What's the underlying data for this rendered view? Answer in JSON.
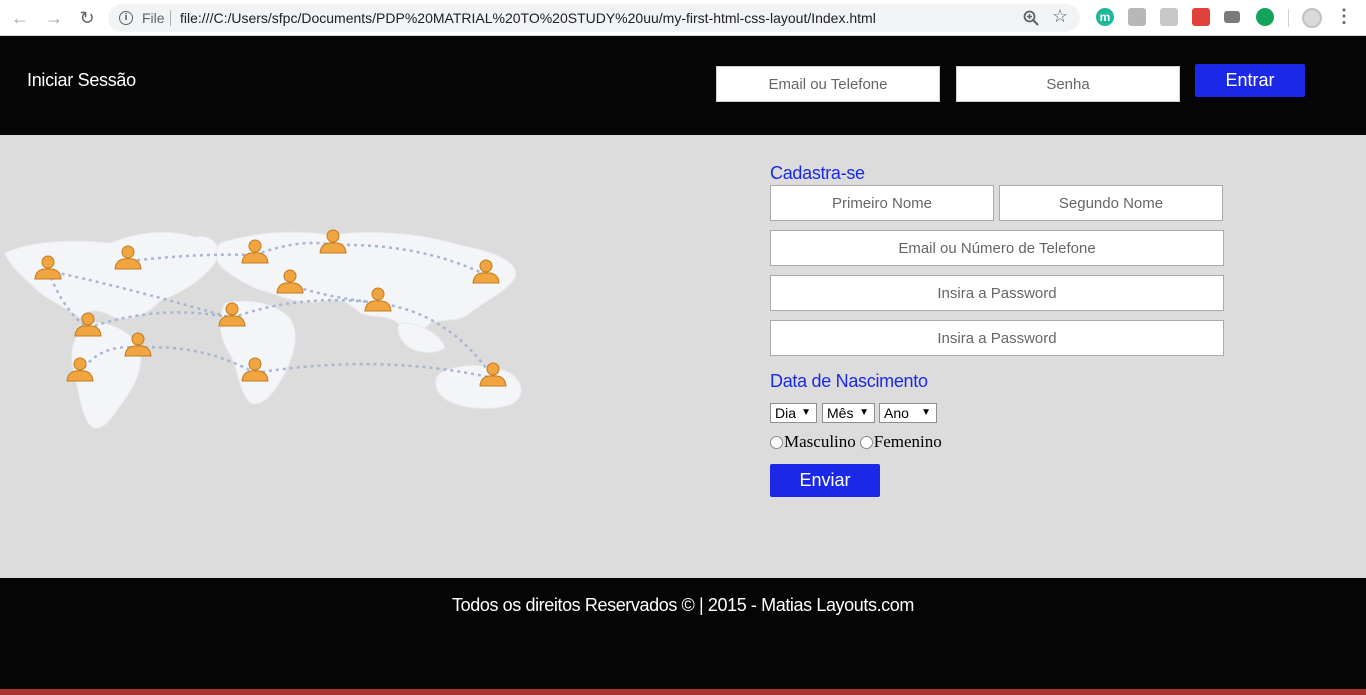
{
  "browser": {
    "scheme_label": "File",
    "url": "file:///C:/Users/sfpc/Documents/PDP%20MATRIAL%20TO%20STUDY%20uu/my-first-html-css-layout/Index.html",
    "icons": [
      "back-arrow-icon",
      "forward-arrow-icon",
      "reload-icon",
      "info-icon",
      "zoom-icon",
      "star-icon",
      "extension-icons",
      "profile-avatar-icon",
      "menu-dots-icon"
    ]
  },
  "header": {
    "title": "Iniciar Sessão",
    "email_placeholder": "Email ou Telefone",
    "password_placeholder": "Senha",
    "login_button": "Entrar"
  },
  "signup": {
    "title": "Cadastra-se",
    "first_name_placeholder": "Primeiro Nome",
    "last_name_placeholder": "Segundo Nome",
    "contact_placeholder": "Email ou Número de Telefone",
    "password_placeholder": "Insira a Password",
    "password_confirm_placeholder": "Insira a Password",
    "birth_title": "Data de Nascimento",
    "day_select": "Dia",
    "month_select": "Mês",
    "year_select": "Ano",
    "gender_male": "Masculino",
    "gender_female": "Femenino",
    "submit_button": "Enviar"
  },
  "footer": {
    "text": "Todos os direitos Reservados © | 2015 - Matias Layouts.com"
  },
  "colors": {
    "accent": "#1b29e6",
    "header_bg": "#050505",
    "main_bg": "#dcdcdc",
    "person_icon": "#f0a540"
  }
}
